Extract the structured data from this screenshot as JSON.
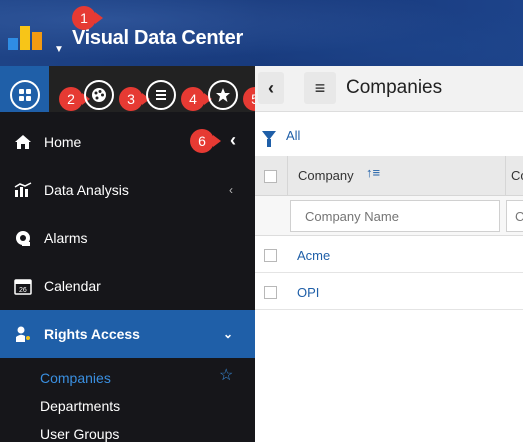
{
  "header": {
    "app_title": "Visual Data Center",
    "logo_icon": "bar-chart-logo-icon"
  },
  "markers": [
    "1",
    "2",
    "3",
    "4",
    "5",
    "6"
  ],
  "toolbar": {
    "icons": [
      "apps-grid-icon",
      "palette-icon",
      "list-icon",
      "star-icon"
    ]
  },
  "sidebar": {
    "items": [
      {
        "label": "Home",
        "icon": "home-icon"
      },
      {
        "label": "Data Analysis",
        "icon": "chart-icon"
      },
      {
        "label": "Alarms",
        "icon": "alarm-icon"
      },
      {
        "label": "Calendar",
        "icon": "calendar-icon"
      },
      {
        "label": "Rights Access",
        "icon": "user-key-icon"
      }
    ],
    "subitems": [
      "Companies",
      "Departments",
      "User Groups"
    ]
  },
  "content": {
    "page_title": "Companies",
    "filter_label": "All",
    "columns": [
      "Company",
      "Co"
    ],
    "filter_placeholder": "Company Name",
    "filter_placeholder2": "C",
    "rows": [
      "Acme",
      "OPI"
    ]
  },
  "colors": {
    "header_bg": "#1c3f82",
    "accent": "#1f5fa8",
    "sidebar_bg": "#16161a",
    "marker": "#e63a33"
  }
}
